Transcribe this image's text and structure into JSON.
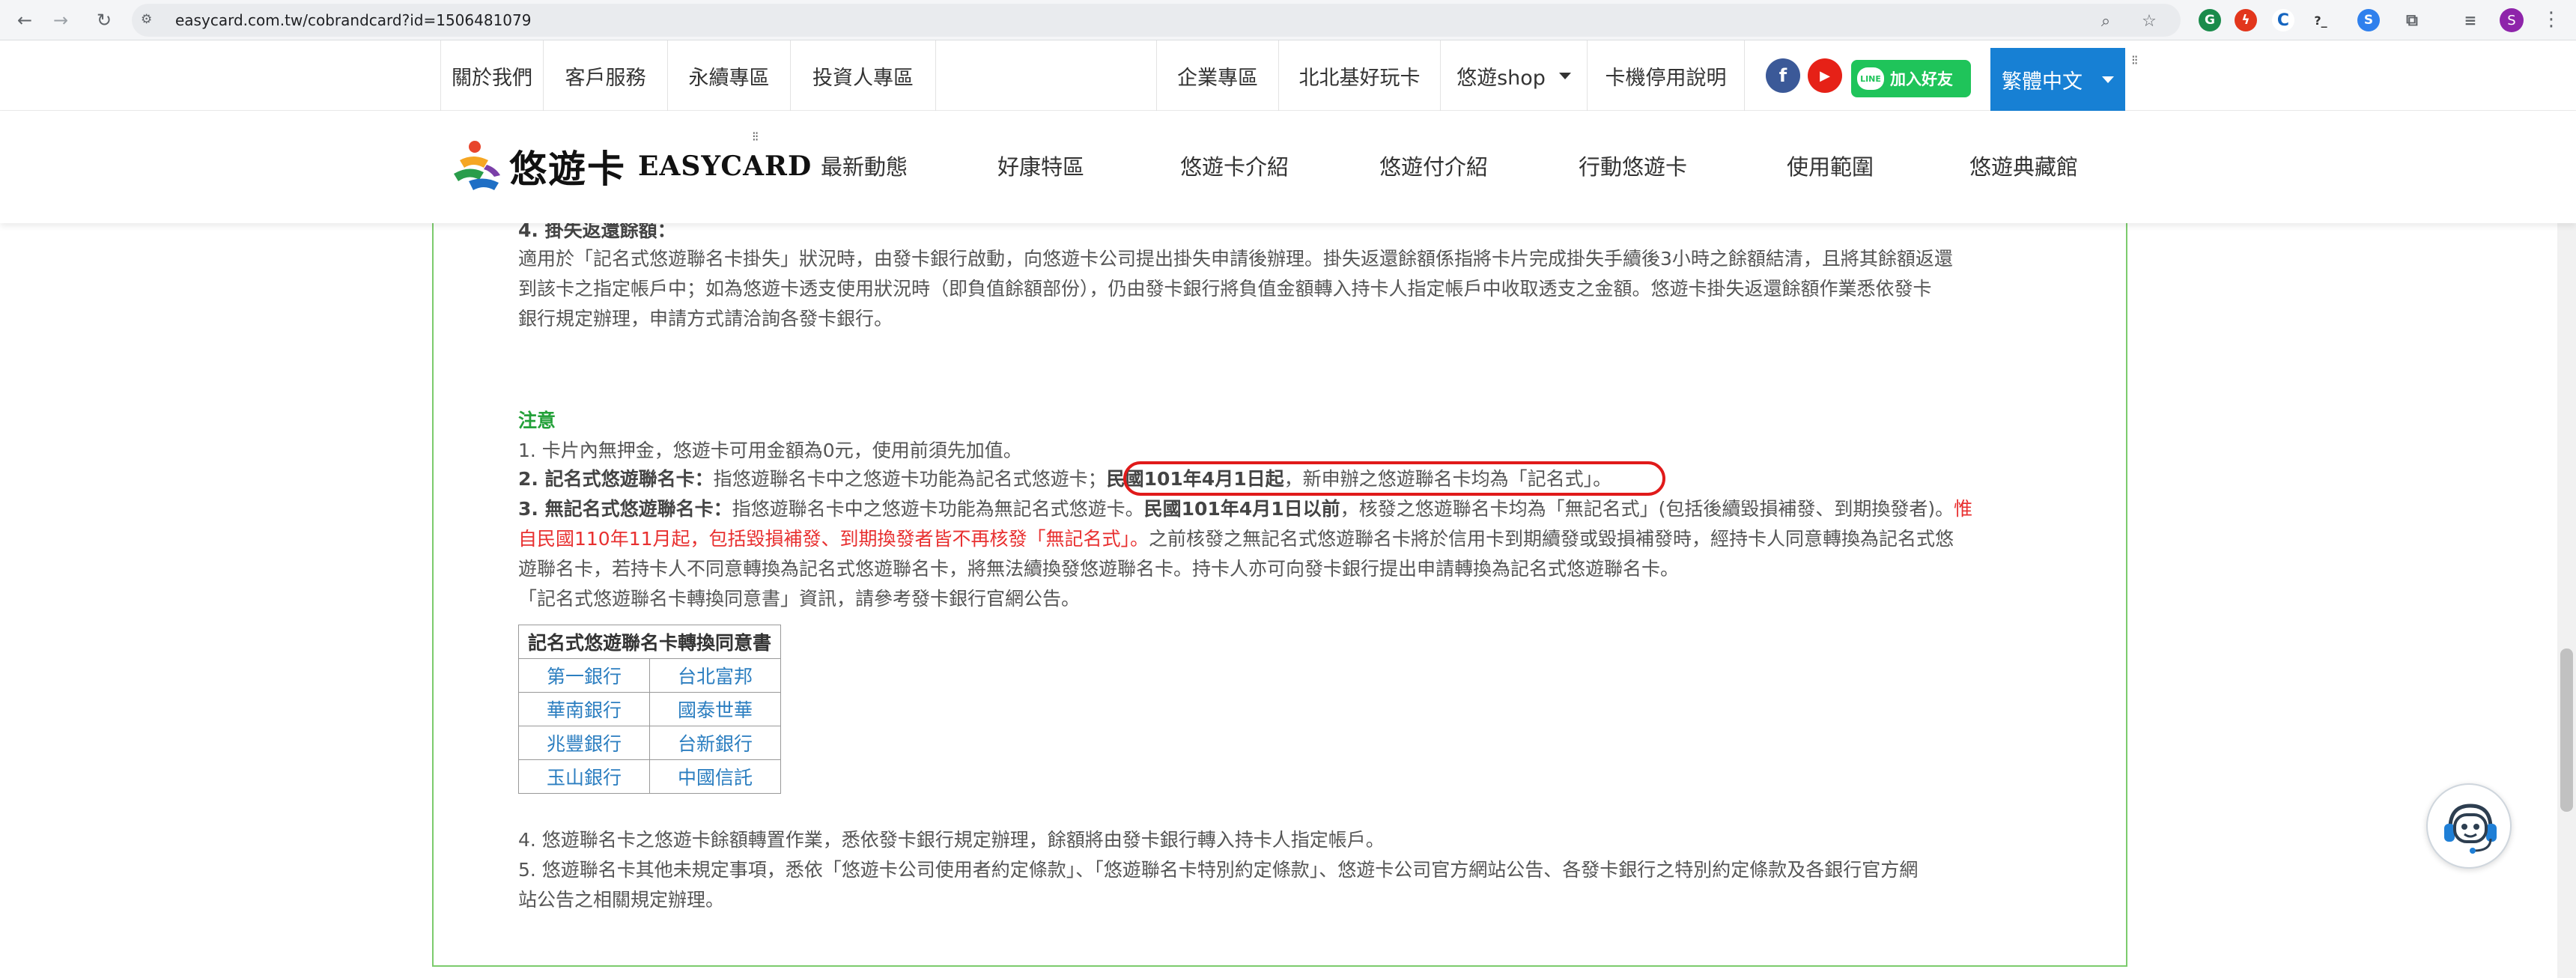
{
  "browser": {
    "url": "easycard.com.tw/cobrandcard?id=1506481079",
    "avatar_letter": "S",
    "extension_label": "?_"
  },
  "utility_nav": {
    "left_items": [
      "關於我們",
      "客戶服務",
      "永續專區",
      "投資人專區"
    ],
    "right_items": [
      "企業專區",
      "北北基好玩卡",
      "悠遊shop",
      "卡機停用說明"
    ],
    "facebook": "f",
    "youtube": "▶",
    "line_logo": "LINE",
    "line_button": "加入好友",
    "language": "繁體中文",
    "colors": {
      "language_bg": "#1780d4",
      "line_bg": "#1fc45a",
      "facebook": "#3b5998",
      "youtube": "#e62117"
    }
  },
  "logo": {
    "zh": "悠遊卡",
    "en": "EASYCARD"
  },
  "main_nav": {
    "items": [
      "最新動態",
      "好康特區",
      "悠遊卡介紹",
      "悠遊付介紹",
      "行動悠遊卡",
      "使用範圍",
      "悠遊典藏館"
    ]
  },
  "content": {
    "section4_title": "4. 掛失返還餘額：",
    "section4_line1": "適用於「記名式悠遊聯名卡掛失」狀況時，由發卡銀行啟動，向悠遊卡公司提出掛失申請後辦理。掛失返還餘額係指將卡片完成掛失手續後3小時之餘額結清，且將其餘額返還",
    "section4_line2": "到該卡之指定帳戶中；如為悠遊卡透支使用狀況時（即負值餘額部份），仍由發卡銀行將負值金額轉入持卡人指定帳戶中收取透支之金額。悠遊卡掛失返還餘額作業悉依發卡",
    "section4_line3": "銀行規定辦理，申請方式請洽詢各發卡銀行。",
    "notice_title": "注意",
    "note1": "1. 卡片內無押金，悠遊卡可用金額為0元，使用前須先加值。",
    "note2_label": "2. 記名式悠遊聯名卡：",
    "note2_text": "指悠遊聯名卡中之悠遊卡功能為記名式悠遊卡；",
    "note2_date": "民國101年4月1日起",
    "note2_rest": "，新申辦之悠遊聯名卡均為「記名式」。",
    "note3_label": "3. 無記名式悠遊聯名卡：",
    "note3_text": "指悠遊聯名卡中之悠遊卡功能為無記名式悠遊卡。",
    "note3_date": "民國101年4月1日以前",
    "note3_text2": "，核發之悠遊聯名卡均為「無記名式」(包括後續毀損補發、到期換發者)。",
    "note3_red1": "惟",
    "note3_red2": "自民國110年11月起，包括毀損補發、到期換發者皆不再核發「無記名式」。",
    "note3_line2_rest": "之前核發之無記名式悠遊聯名卡將於信用卡到期續發或毀損補發時，經持卡人同意轉換為記名式悠",
    "note3_line3": "遊聯名卡，若持卡人不同意轉換為記名式悠遊聯名卡，將無法續換發悠遊聯名卡。持卡人亦可向發卡銀行提出申請轉換為記名式悠遊聯名卡。",
    "consent_line": "「記名式悠遊聯名卡轉換同意書」資訊，請參考發卡銀行官網公告。",
    "table_header": "記名式悠遊聯名卡轉換同意書",
    "table_rows": [
      [
        "第一銀行",
        "台北富邦"
      ],
      [
        "華南銀行",
        "國泰世華"
      ],
      [
        "兆豐銀行",
        "台新銀行"
      ],
      [
        "玉山銀行",
        "中國信託"
      ]
    ],
    "note4": "4. 悠遊聯名卡之悠遊卡餘額轉置作業，悉依發卡銀行規定辦理，餘額將由發卡銀行轉入持卡人指定帳戶。",
    "note5_line1": "5. 悠遊聯名卡其他未規定事項，悉依「悠遊卡公司使用者約定條款」、「悠遊聯名卡特別約定條款」、悠遊卡公司官方網站公告、各發卡銀行之特別約定條款及各銀行官方網",
    "note5_line2": "站公告之相關規定辦理。"
  }
}
